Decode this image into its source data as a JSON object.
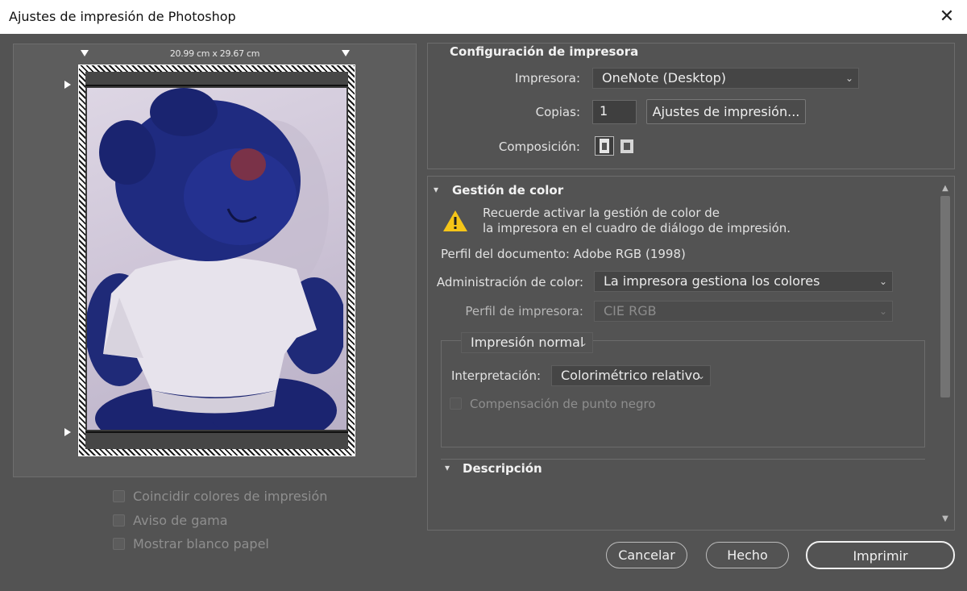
{
  "window": {
    "title": "Ajustes de impresión de Photoshop",
    "close_glyph": "✕"
  },
  "preview": {
    "dimensions": "20.99 cm x 29.67 cm"
  },
  "left_options": [
    {
      "label": "Coincidir colores de impresión",
      "checked": false,
      "enabled": false
    },
    {
      "label": "Aviso de gama",
      "checked": false,
      "enabled": false
    },
    {
      "label": "Mostrar blanco papel",
      "checked": false,
      "enabled": false
    }
  ],
  "printer_setup": {
    "title": "Configuración de impresora",
    "printer_label": "Impresora:",
    "printer_value": "OneNote (Desktop)",
    "copies_label": "Copias:",
    "copies_value": "1",
    "print_settings_button": "Ajustes de impresión...",
    "layout_label": "Composición:"
  },
  "color_management": {
    "title": "Gestión de color",
    "warning_line1": "Recuerde activar la gestión de color de",
    "warning_line2": "la impresora en el cuadro de diálogo de impresión.",
    "document_profile": "Perfil del documento: Adobe RGB (1998)",
    "color_handling_label": "Administración de color:",
    "color_handling_value": "La impresora gestiona los colores",
    "printer_profile_label": "Perfil de impresora:",
    "printer_profile_value": "CIE RGB",
    "mode_value": "Impresión normal",
    "intent_label": "Interpretación:",
    "intent_value": "Colorimétrico relativo",
    "black_point_label": "Compensación de punto negro"
  },
  "description": {
    "title": "Descripción"
  },
  "buttons": {
    "cancel": "Cancelar",
    "done": "Hecho",
    "print": "Imprimir"
  },
  "colors": {
    "background": "#535353",
    "panel": "#5d5d5d",
    "warning": "#f5c518"
  }
}
